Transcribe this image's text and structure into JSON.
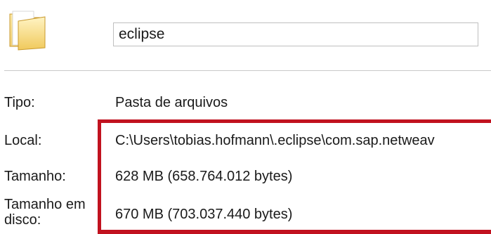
{
  "header": {
    "icon": "folder-icon",
    "name_value": "eclipse"
  },
  "properties": {
    "tipo_label": "Tipo:",
    "tipo_value": "Pasta de arquivos",
    "local_label": "Local:",
    "local_value": "C:\\Users\\tobias.hofmann\\.eclipse\\com.sap.netweav",
    "tamanho_label": "Tamanho:",
    "tamanho_value": "628 MB (658.764.012 bytes)",
    "disco_label": "Tamanho em disco:",
    "disco_value": "670 MB (703.037.440 bytes)"
  },
  "colors": {
    "highlight": "#c1121f",
    "folder": "#f3cf6a"
  }
}
